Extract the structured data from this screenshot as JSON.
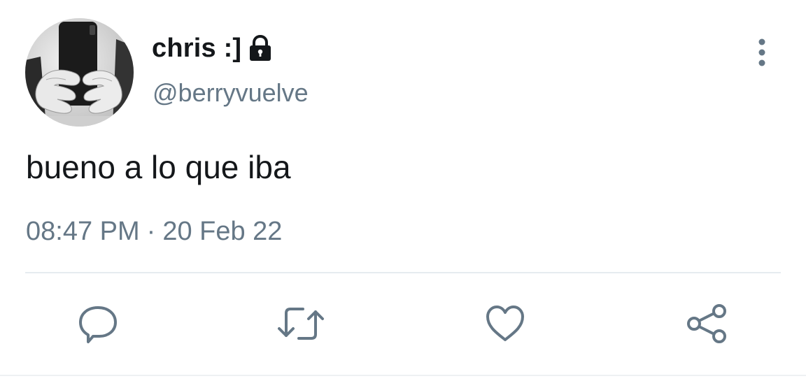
{
  "author": {
    "display_name": "chris :]",
    "handle": "@berryvuelve",
    "protected": true,
    "avatar": "photo-of-hands-holding-phone"
  },
  "tweet": {
    "text": "bueno a lo que iba",
    "time": "08:47 PM",
    "separator": "·",
    "date": "20 Feb 22"
  },
  "icons": {
    "more": "more-vertical-icon",
    "reply": "reply-icon",
    "retweet": "retweet-icon",
    "like": "heart-icon",
    "share": "share-icon",
    "lock": "lock-icon"
  },
  "colors": {
    "text": "#14171a",
    "secondary": "#657786",
    "divider": "#e6ecf0"
  }
}
